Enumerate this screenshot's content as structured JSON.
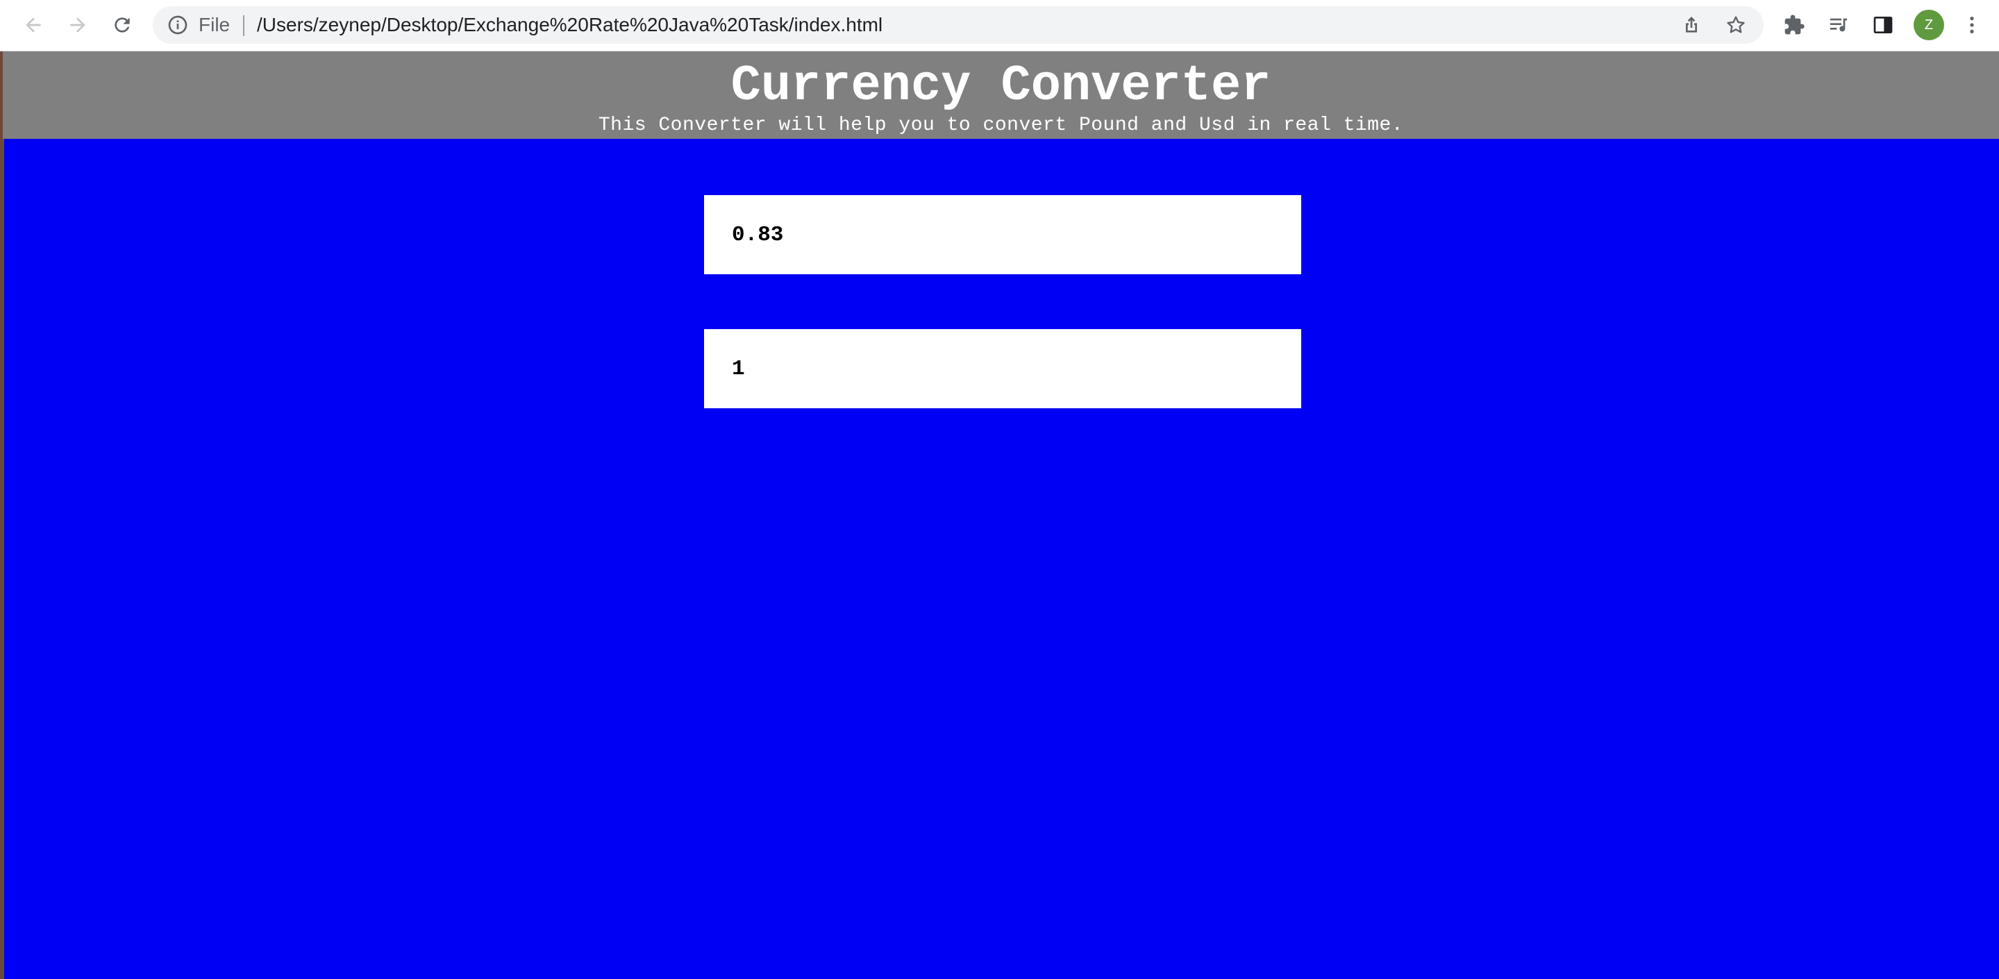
{
  "browser": {
    "scheme_label": "File",
    "url": "/Users/zeynep/Desktop/Exchange%20Rate%20Java%20Task/index.html",
    "avatar_initial": "Z",
    "avatar_color": "#5f9a3f"
  },
  "page": {
    "title": "Currency Converter",
    "subtitle": "This Converter will help you to convert Pound and Usd in real time.",
    "header_color": "#808080",
    "background_color": "#0000f5"
  },
  "converter": {
    "pound_value": "0.83",
    "usd_value": "1"
  },
  "icons": {
    "back": "arrow-left-icon",
    "forward": "arrow-right-icon",
    "reload": "reload-icon",
    "info": "info-icon",
    "share": "share-icon",
    "bookmark": "star-icon",
    "extensions": "puzzle-icon",
    "media": "media-queue-icon",
    "side_panel": "side-panel-icon",
    "menu": "kebab-menu-icon"
  }
}
